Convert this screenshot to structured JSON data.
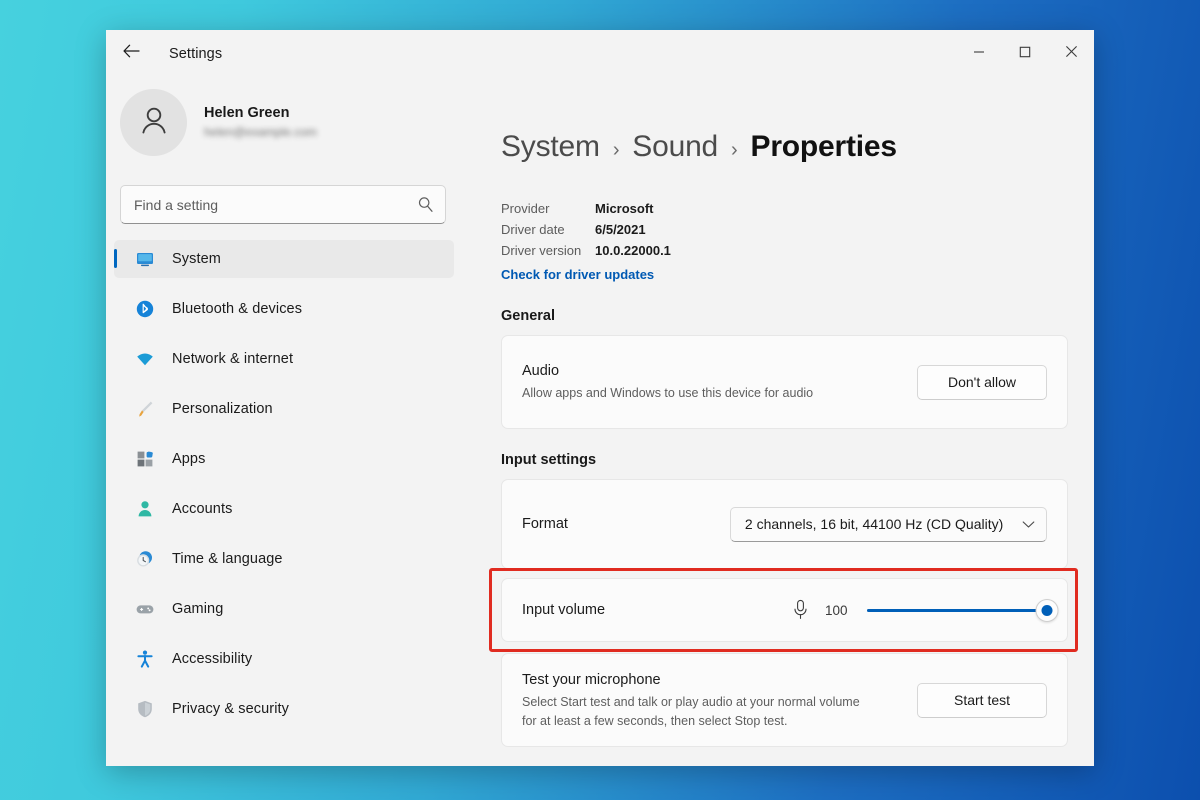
{
  "titlebar": {
    "back_icon": "back-arrow-icon",
    "title": "Settings",
    "minimize_icon": "minimize-icon",
    "maximize_icon": "maximize-icon",
    "close_icon": "close-icon"
  },
  "sidebar": {
    "account": {
      "name": "Helen Green",
      "email": "helen@example.com",
      "avatar_icon": "person-avatar-icon"
    },
    "search": {
      "placeholder": "Find a setting",
      "value": "",
      "icon": "search-icon"
    },
    "items": [
      {
        "label": "System",
        "icon": "monitor-icon",
        "selected": true
      },
      {
        "label": "Bluetooth & devices",
        "icon": "bluetooth-icon",
        "selected": false
      },
      {
        "label": "Network & internet",
        "icon": "wifi-icon",
        "selected": false
      },
      {
        "label": "Personalization",
        "icon": "paintbrush-icon",
        "selected": false
      },
      {
        "label": "Apps",
        "icon": "apps-icon",
        "selected": false
      },
      {
        "label": "Accounts",
        "icon": "accounts-person-icon",
        "selected": false
      },
      {
        "label": "Time & language",
        "icon": "clock-icon",
        "selected": false
      },
      {
        "label": "Gaming",
        "icon": "gamepad-icon",
        "selected": false
      },
      {
        "label": "Accessibility",
        "icon": "accessibility-icon",
        "selected": false
      },
      {
        "label": "Privacy & security",
        "icon": "shield-icon",
        "selected": false
      }
    ]
  },
  "content": {
    "breadcrumb": {
      "items": [
        "System",
        "Sound",
        "Properties"
      ],
      "separator": "›"
    },
    "driver": {
      "rows": [
        {
          "label": "Provider",
          "value": "Microsoft"
        },
        {
          "label": "Driver date",
          "value": "6/5/2021"
        },
        {
          "label": "Driver version",
          "value": "10.0.22000.1"
        }
      ],
      "link": "Check for driver updates"
    },
    "general": {
      "heading": "General",
      "audio": {
        "title": "Audio",
        "description": "Allow apps and Windows to use this device for audio",
        "button": "Don't allow"
      }
    },
    "input_settings": {
      "heading": "Input settings",
      "format": {
        "label": "Format",
        "value": "2 channels, 16 bit, 44100 Hz (CD Quality)",
        "chevron_icon": "chevron-down-icon"
      },
      "input_volume": {
        "label": "Input volume",
        "mic_icon": "microphone-icon",
        "value": "100",
        "percent": 100,
        "highlighted": true,
        "highlight_color": "#e02b20"
      },
      "test_microphone": {
        "title": "Test your microphone",
        "description": "Select Start test and talk or play audio at your normal volume for at least a few seconds, then select Stop test.",
        "button": "Start test"
      }
    }
  },
  "colors": {
    "accent": "#005fb8",
    "link": "#0059b3",
    "highlight": "#e02b20",
    "window_bg": "#f3f3f3",
    "card_bg": "#fbfbfb",
    "desktop_gradient_start": "#46d1de",
    "desktop_gradient_end": "#0c4fae"
  }
}
